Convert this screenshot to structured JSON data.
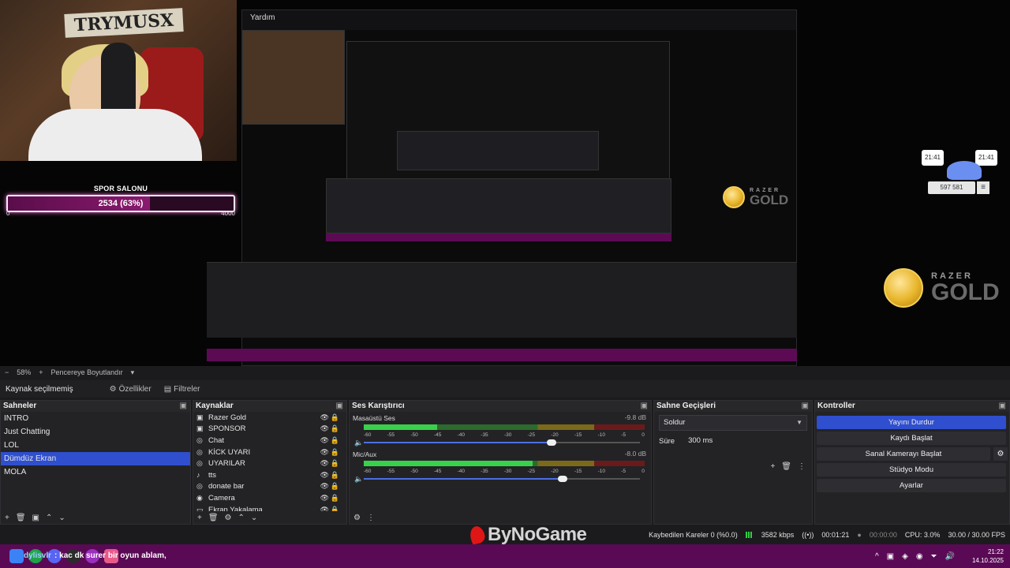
{
  "window": {
    "menu_label": "Yardım"
  },
  "preview": {
    "nested_title": "Yardım",
    "goal": {
      "title": "SPOR SALONU",
      "text": "2534 (63%)",
      "min": "0",
      "max": "4000",
      "progress_fraction": 0.63
    },
    "webcam_sign": "TRYMUSX",
    "razer": {
      "brand": "RAZER",
      "product": "GOLD"
    },
    "cat_widget": {
      "time_left": "21:41",
      "time_right": "21:41",
      "count": "597 581",
      "menu_icon": "hamburger-icon"
    }
  },
  "zoom": {
    "minus": "−",
    "level": "58%",
    "plus": "+",
    "fit_label": "Pencereye Boyutlandır"
  },
  "source_toolbar": {
    "status": "Kaynak seçilmemiş",
    "properties": "Özellikler",
    "filters": "Filtreler"
  },
  "docks": {
    "scenes": {
      "title": "Sahneler",
      "items": [
        {
          "label": "INTRO",
          "selected": false
        },
        {
          "label": "Just Chatting",
          "selected": false
        },
        {
          "label": "LOL",
          "selected": false
        },
        {
          "label": "Dümdüz Ekran",
          "selected": true
        },
        {
          "label": "MOLA",
          "selected": false
        }
      ]
    },
    "sources": {
      "title": "Kaynaklar",
      "items": [
        {
          "label": "Razer Gold",
          "icon": "image-icon"
        },
        {
          "label": "SPONSOR",
          "icon": "image-icon"
        },
        {
          "label": "Chat",
          "icon": "browser-icon"
        },
        {
          "label": "KİCK UYARI",
          "icon": "browser-icon"
        },
        {
          "label": "UYARILAR",
          "icon": "browser-icon"
        },
        {
          "label": "tts",
          "icon": "audio-icon"
        },
        {
          "label": "donate bar",
          "icon": "browser-icon"
        },
        {
          "label": "Camera",
          "icon": "camera-icon"
        },
        {
          "label": "Ekran Yakalama",
          "icon": "monitor-icon"
        }
      ]
    },
    "mixer": {
      "title": "Ses Karıştırıcı",
      "ticks": [
        "-60",
        "-55",
        "-50",
        "-45",
        "-40",
        "-35",
        "-30",
        "-25",
        "-20",
        "-15",
        "-10",
        "-5",
        "0"
      ],
      "tracks": [
        {
          "name": "Masaüstü Ses",
          "db": "-9.8 dB",
          "level_fraction": 0.26,
          "volume_fraction": 0.68
        },
        {
          "name": "Mic/Aux",
          "db": "-8.0 dB",
          "level_fraction": 0.6,
          "volume_fraction": 0.72
        }
      ]
    },
    "transitions": {
      "title": "Sahne Geçişleri",
      "selected": "Soldur",
      "duration_label": "Süre",
      "duration_value": "300 ms"
    },
    "controls": {
      "title": "Kontroller",
      "buttons": [
        "Yayını Durdur",
        "Kaydı Başlat",
        "Sanal Kamerayı Başlat",
        "Stüdyo Modu",
        "Ayarlar"
      ]
    }
  },
  "status": {
    "brand": "ByNoGame",
    "dropped_frames": "Kaybedilen Kareler 0 (%0.0)",
    "bitrate": "3582 kbps",
    "stream_time": "00:01:21",
    "record_time": "00:00:00",
    "cpu": "CPU: 3.0%",
    "fps": "30.00 / 30.00 FPS"
  },
  "taskbar": {
    "chat_user": "dylisvlr",
    "chat_message": ": kac dk surer bir oyun ablam,",
    "time": "21:22",
    "date": "14.10.2025",
    "chevron": "^"
  },
  "colors": {
    "accent": "#2f4fce",
    "taskbar": "#5a0a55",
    "meter_green": "#39d14b"
  }
}
